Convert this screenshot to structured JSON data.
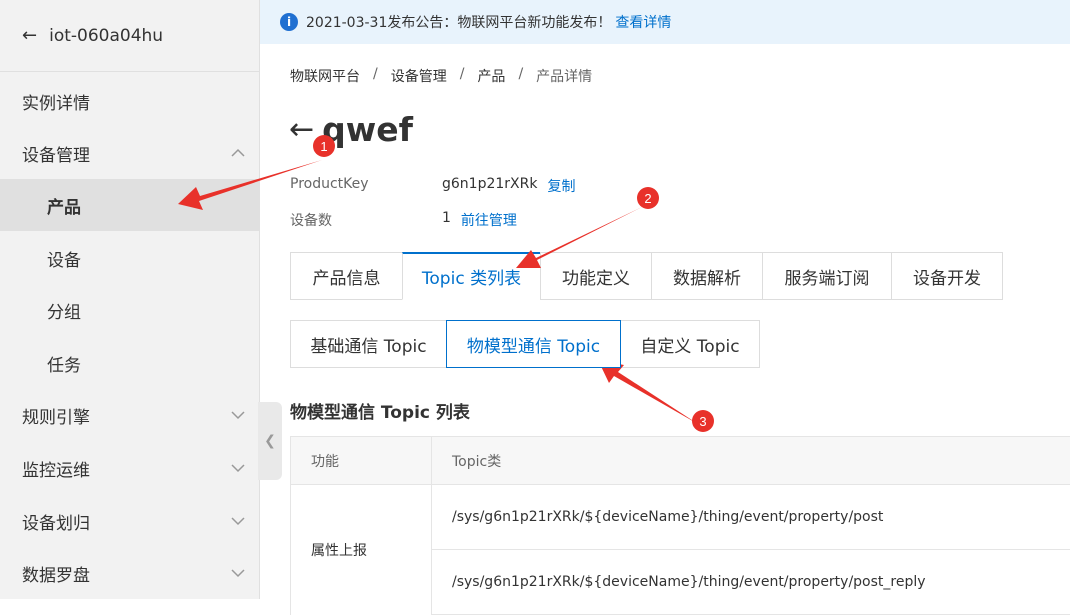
{
  "sidebar": {
    "title": "iot-060a04hu",
    "items": [
      {
        "label": "实例详情"
      },
      {
        "label": "设备管理"
      },
      {
        "label": "产品"
      },
      {
        "label": "设备"
      },
      {
        "label": "分组"
      },
      {
        "label": "任务"
      },
      {
        "label": "规则引擎"
      },
      {
        "label": "监控运维"
      },
      {
        "label": "设备划归"
      },
      {
        "label": "数据罗盘"
      }
    ]
  },
  "notice": {
    "icon": "info-icon",
    "text": "2021-03-31发布公告：物联网平台新功能发布！",
    "link": "查看详情"
  },
  "breadcrumb": [
    "物联网平台",
    "设备管理",
    "产品",
    "产品详情"
  ],
  "product": {
    "name": "qwef",
    "productkey_label": "ProductKey",
    "productkey_value": "g6n1p21rXRk",
    "copy_label": "复制",
    "device_count_label": "设备数",
    "device_count_value": "1",
    "manage_label": "前往管理"
  },
  "tabs": [
    "产品信息",
    "Topic 类列表",
    "功能定义",
    "数据解析",
    "服务端订阅",
    "设备开发"
  ],
  "subtabs": [
    "基础通信 Topic",
    "物模型通信 Topic",
    "自定义 Topic"
  ],
  "section_title": "物模型通信 Topic 列表",
  "table": {
    "headers": [
      "功能",
      "Topic类"
    ],
    "rows": [
      {
        "function": "属性上报",
        "topics": [
          "/sys/g6n1p21rXRk/${deviceName}/thing/event/property/post",
          "/sys/g6n1p21rXRk/${deviceName}/thing/event/property/post_reply"
        ]
      }
    ]
  },
  "annotations": [
    "1",
    "2",
    "3"
  ],
  "colors": {
    "accent": "#0070cc",
    "annotation": "#e8312a"
  }
}
